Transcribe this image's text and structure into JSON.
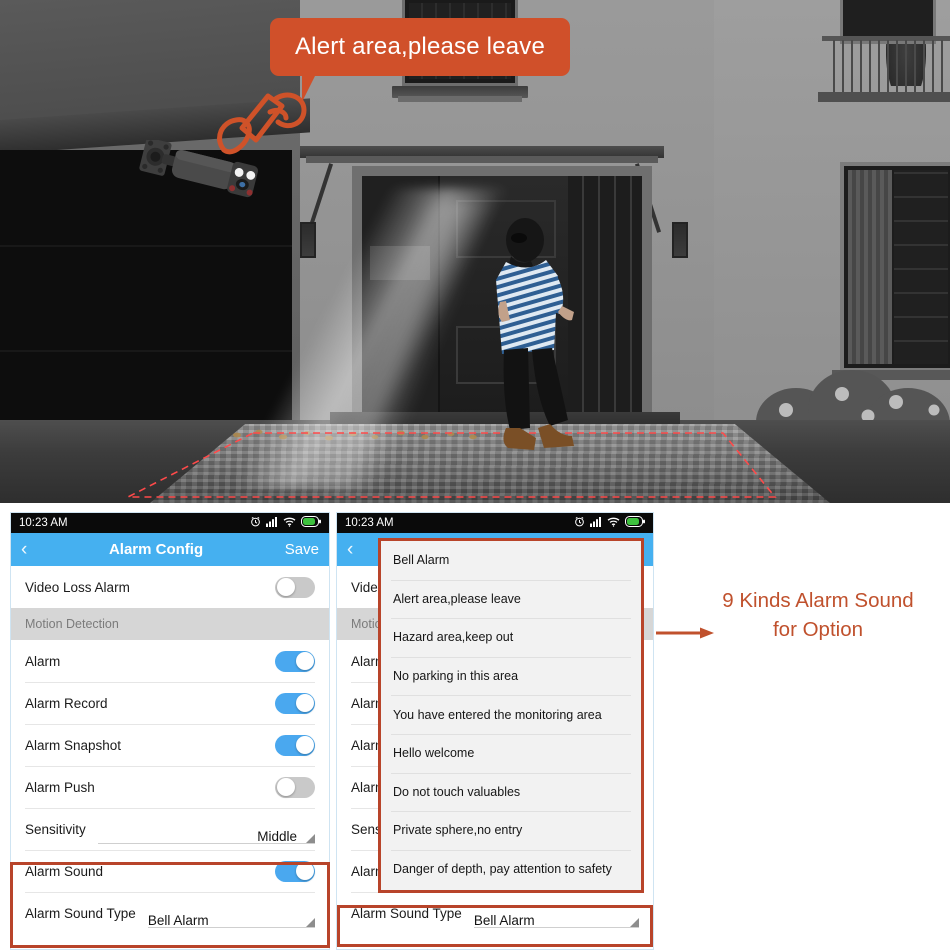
{
  "scene": {
    "speech_bubble": "Alert area,please leave",
    "bubble_color": "#d0502a",
    "horn_icon": "megaphone-icon",
    "camera_icon": "security-camera",
    "detection_zone_color": "#ff4d4d"
  },
  "phone1": {
    "statusbar": {
      "time": "10:23  AM",
      "icons": [
        "alarm-clock-icon",
        "signal-icon",
        "wifi-icon",
        "battery-icon"
      ]
    },
    "navbar": {
      "back": "‹",
      "title": "Alarm Config",
      "save": "Save"
    },
    "rows": [
      {
        "label": "Video Loss Alarm",
        "type": "toggle",
        "state": "off"
      },
      {
        "label": "Motion Detection",
        "type": "section"
      },
      {
        "label": "Alarm",
        "type": "toggle",
        "state": "on"
      },
      {
        "label": "Alarm Record",
        "type": "toggle",
        "state": "on"
      },
      {
        "label": "Alarm Snapshot",
        "type": "toggle",
        "state": "on"
      },
      {
        "label": "Alarm Push",
        "type": "toggle",
        "state": "off"
      },
      {
        "label": "Sensitivity",
        "type": "select",
        "value": "Middle"
      },
      {
        "label": "Alarm Sound",
        "type": "toggle",
        "state": "on"
      },
      {
        "label": "Alarm Sound Type",
        "type": "select",
        "value": "Bell Alarm"
      }
    ]
  },
  "phone2": {
    "statusbar": {
      "time": "10:23  AM",
      "icons": [
        "alarm-clock-icon",
        "signal-icon",
        "wifi-icon",
        "battery-icon"
      ]
    },
    "navbar": {
      "back": "‹",
      "title": "",
      "save": ""
    },
    "rows": [
      {
        "label": "Video",
        "type": "toggle",
        "state": "off"
      },
      {
        "label": "Motion",
        "type": "section"
      },
      {
        "label": "Alarm",
        "type": "toggle",
        "state": "on"
      },
      {
        "label": "Alarm",
        "type": "toggle",
        "state": "on"
      },
      {
        "label": "Alarm",
        "type": "toggle",
        "state": "on"
      },
      {
        "label": "Alarm",
        "type": "toggle",
        "state": "off"
      },
      {
        "label": "Sensit",
        "type": "select",
        "value": ""
      },
      {
        "label": "Alarm",
        "type": "toggle",
        "state": "on"
      }
    ],
    "bottom_row": {
      "label": "Alarm Sound Type",
      "value": "Bell Alarm"
    },
    "dropdown": {
      "options": [
        "Bell Alarm",
        "Alert area,please leave",
        "Hazard area,keep out",
        "No parking in this area",
        "You have entered the monitoring area",
        "Hello welcome",
        "Do not touch valuables",
        "Private sphere,no entry",
        "Danger of depth, pay attention to safety"
      ]
    }
  },
  "annotation": {
    "line1": "9 Kinds Alarm Sound",
    "line2": "for Option",
    "color": "#c0512d",
    "arrow_icon": "arrow-right-icon"
  },
  "theme": {
    "accent_blue": "#45b0f0",
    "toggle_on": "#4aa8ef",
    "toggle_off": "#c9c9c9",
    "highlight_border": "#b8442a"
  }
}
